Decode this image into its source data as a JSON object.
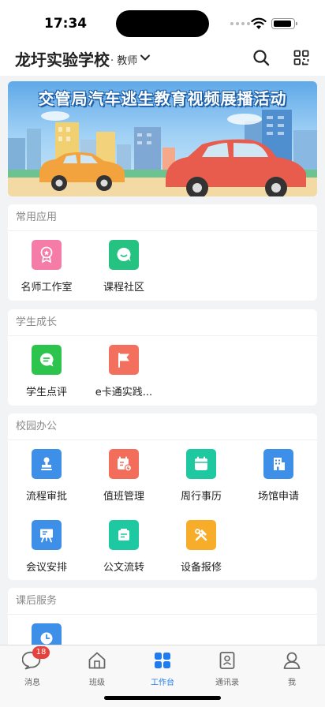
{
  "status_bar": {
    "time": "17:34"
  },
  "header": {
    "school_name": "龙圩实验学校",
    "role": "· 教师"
  },
  "banner": {
    "title": "交管局汽车逃生教育视频展播活动"
  },
  "sections": {
    "common_apps": {
      "title": "常用应用",
      "items": [
        {
          "label": "名师工作室",
          "icon": "award-icon",
          "color": "#f47ca6"
        },
        {
          "label": "课程社区",
          "icon": "chat-bubble-icon",
          "color": "#26c281"
        }
      ]
    },
    "student_growth": {
      "title": "学生成长",
      "items": [
        {
          "label": "学生点评",
          "icon": "comment-icon",
          "color": "#2dc44e"
        },
        {
          "label": "e卡通实践...",
          "icon": "flag-icon",
          "color": "#f36f5e"
        }
      ]
    },
    "campus_office": {
      "title": "校园办公",
      "items": [
        {
          "label": "流程审批",
          "icon": "stamp-icon",
          "color": "#3d8fe8"
        },
        {
          "label": "值班管理",
          "icon": "duty-calendar-icon",
          "color": "#f26d5a"
        },
        {
          "label": "周行事历",
          "icon": "calendar-icon",
          "color": "#1ec8a0"
        },
        {
          "label": "场馆申请",
          "icon": "building-icon",
          "color": "#3d8fe8"
        },
        {
          "label": "会议安排",
          "icon": "meeting-board-icon",
          "color": "#3d8fe8"
        },
        {
          "label": "公文流转",
          "icon": "document-icon",
          "color": "#1ec8a0"
        },
        {
          "label": "设备报修",
          "icon": "tools-icon",
          "color": "#f7ac2a"
        }
      ]
    },
    "after_school": {
      "title": "课后服务",
      "items": [
        {
          "label": "",
          "icon": "clock-icon",
          "color": "#3d8fe8"
        }
      ]
    }
  },
  "tab_bar": {
    "tabs": [
      {
        "label": "消息",
        "icon": "message-icon",
        "badge": "18"
      },
      {
        "label": "班级",
        "icon": "house-icon"
      },
      {
        "label": "工作台",
        "icon": "grid-icon",
        "active": true
      },
      {
        "label": "通讯录",
        "icon": "contacts-icon"
      },
      {
        "label": "我",
        "icon": "person-icon"
      }
    ]
  },
  "colors": {
    "accent": "#1f7cf0",
    "badge": "#e8403a"
  }
}
